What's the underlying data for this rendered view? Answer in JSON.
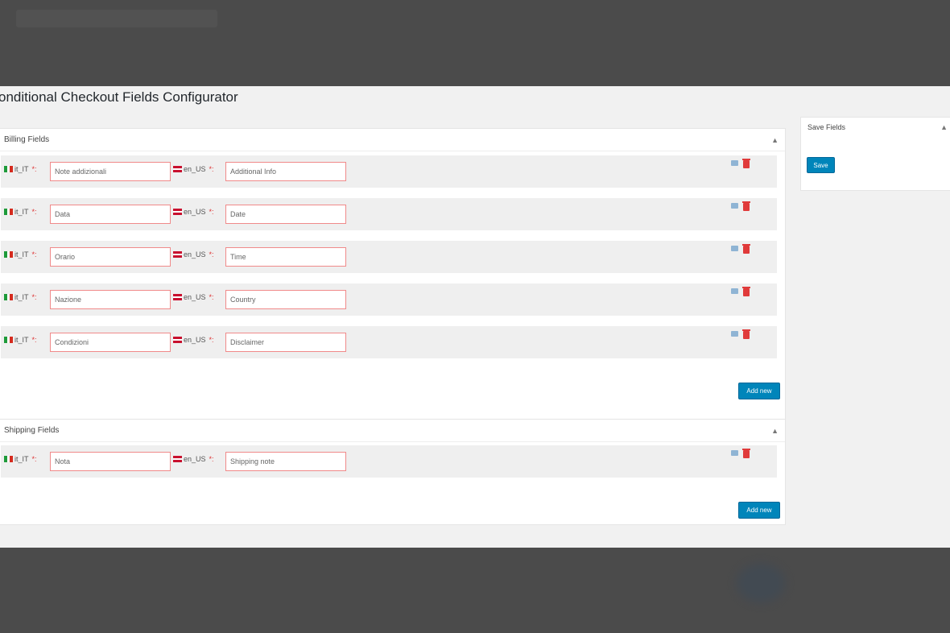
{
  "page": {
    "title": "onditional Checkout Fields Configurator"
  },
  "billing": {
    "title": "Billing Fields",
    "toggle": "▲",
    "add_label": "Add new",
    "rows": [
      {
        "lang1": "it_IT",
        "value1": "Note addizionali",
        "lang2": "en_US",
        "value2": "Additional Info"
      },
      {
        "lang1": "it_IT",
        "value1": "Data",
        "lang2": "en_US",
        "value2": "Date"
      },
      {
        "lang1": "it_IT",
        "value1": "Orario",
        "lang2": "en_US",
        "value2": "Time"
      },
      {
        "lang1": "it_IT",
        "value1": "Nazione",
        "lang2": "en_US",
        "value2": "Country"
      },
      {
        "lang1": "it_IT",
        "value1": "Condizioni",
        "lang2": "en_US",
        "value2": "Disclaimer"
      }
    ]
  },
  "shipping": {
    "title": "Shipping Fields",
    "toggle": "▲",
    "add_label": "Add new",
    "rows": [
      {
        "lang1": "it_IT",
        "value1": "Nota",
        "lang2": "en_US",
        "value2": "Shipping note"
      }
    ]
  },
  "sidebar": {
    "title": "Save Fields",
    "toggle": "▲",
    "save_label": "Save"
  },
  "colors": {
    "primary": "#0085ba",
    "required_border": "#f08a8a",
    "delete": "#e03a3a",
    "edit": "#8fb4d4"
  },
  "icons": {
    "flag_it": "italy-flag-icon",
    "flag_uk": "uk-flag-icon",
    "edit": "edit-icon",
    "delete": "trash-icon"
  }
}
